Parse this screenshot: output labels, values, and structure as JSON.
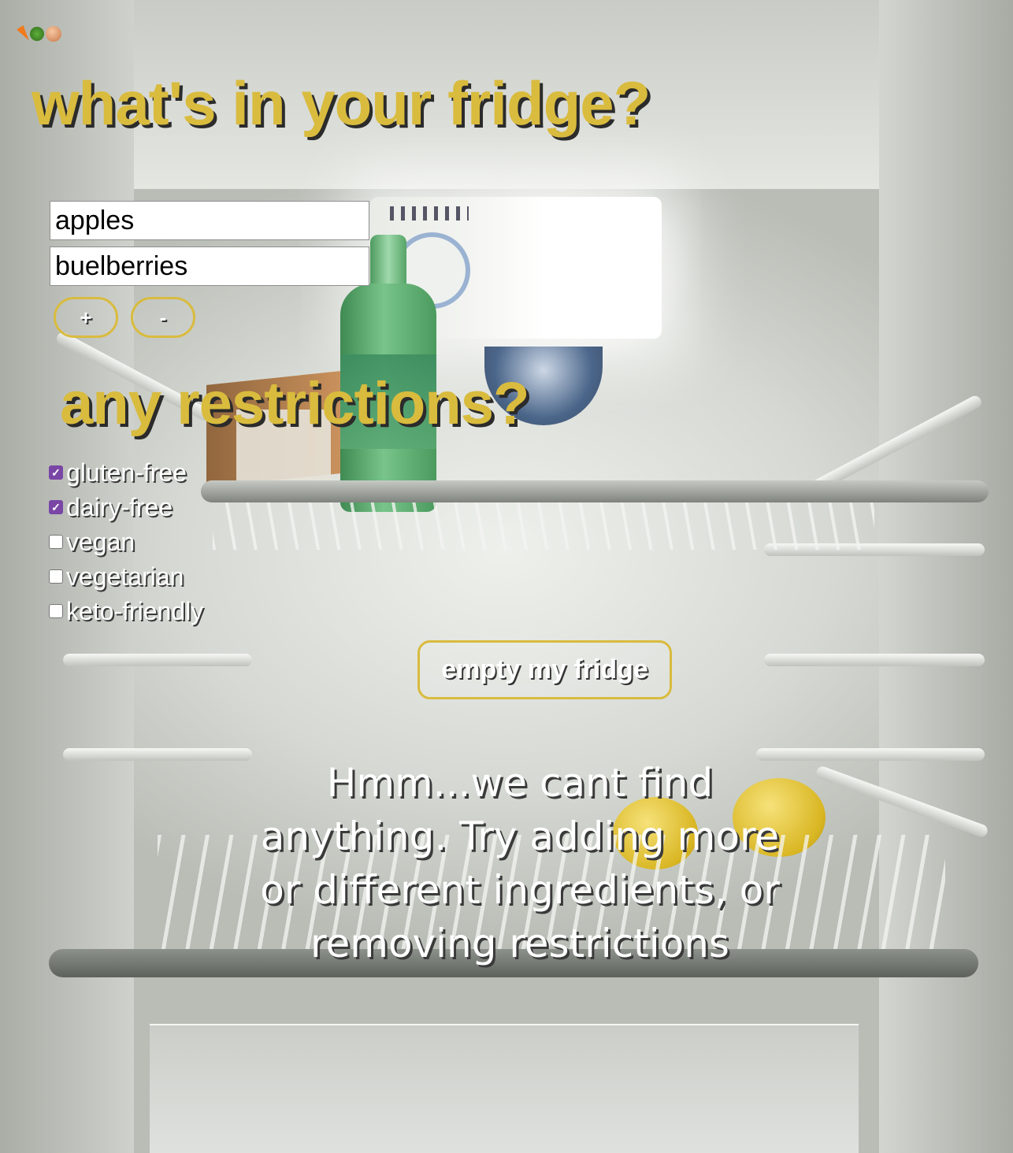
{
  "header": {
    "emoji_icons": [
      "carrot-icon",
      "broccoli-icon",
      "onion-icon"
    ],
    "title": "what's in your fridge?"
  },
  "ingredients": {
    "items": [
      "apples",
      "buelberries"
    ],
    "add_label": "+",
    "remove_label": "-"
  },
  "restrictions": {
    "title": "any restrictions?",
    "options": [
      {
        "label": "gluten-free",
        "checked": true
      },
      {
        "label": "dairy-free",
        "checked": true
      },
      {
        "label": "vegan",
        "checked": false
      },
      {
        "label": "vegetarian",
        "checked": false
      },
      {
        "label": "keto-friendly",
        "checked": false
      }
    ]
  },
  "action": {
    "submit_label": "empty my fridge"
  },
  "result": {
    "message": "Hmm...we cant find anything. Try adding more or different ingredients, or removing restrictions"
  },
  "colors": {
    "accent": "#d9bb3e",
    "checkbox_checked": "#7a46a6",
    "text": "#ffffff"
  }
}
